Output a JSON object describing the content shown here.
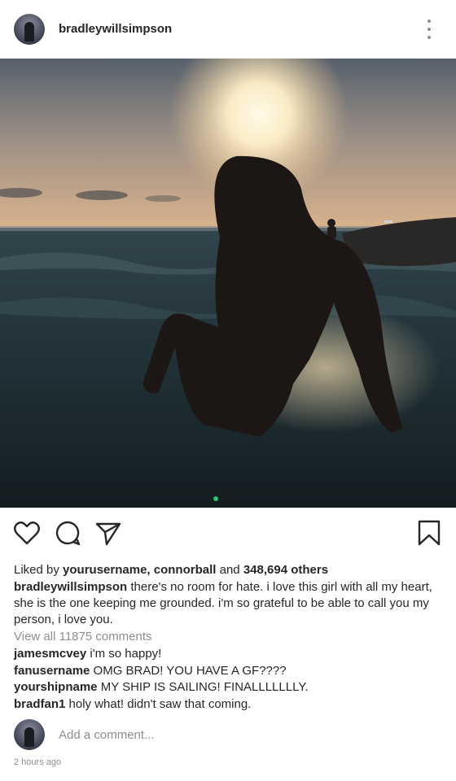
{
  "post": {
    "username": "bradleywillsimpson",
    "menu_icon": "more-vertical-icon",
    "photo": {
      "description_colors": {
        "sky_top": "#5e6a78",
        "sky_horizon": "#d9b48f",
        "sun": "#fff6dc",
        "sea": "#1f3238",
        "silhouette": "#1a1614"
      },
      "carousel_dot_color": "#2fbf71"
    },
    "actions": {
      "like_icon": "heart-icon",
      "comment_icon": "comment-icon",
      "share_icon": "send-icon",
      "save_icon": "bookmark-icon"
    },
    "likes": {
      "prefix": "Liked by ",
      "names": "yourusername, connorball",
      "middle": " and ",
      "count": "348,694 others"
    },
    "caption": {
      "author": "bradleywillsimpson",
      "text": " there's no room for hate. i love this girl with all my heart, she is the one keeping me grounded. i'm so grateful to be able to call you my person, i love you."
    },
    "view_all_comments": "View all 11875 comments",
    "comments": [
      {
        "user": "jamesmcvey",
        "text": " i'm so happy!"
      },
      {
        "user": "fanusername",
        "text": " OMG BRAD! YOU HAVE A GF????"
      },
      {
        "user": "yourshipname",
        "text": " MY SHIP IS SAILING! FINALLLLLLLY."
      },
      {
        "user": "bradfan1",
        "text": " holy what! didn't saw that coming."
      }
    ],
    "add_comment_placeholder": "Add a comment...",
    "timestamp": "2 hours ago"
  }
}
